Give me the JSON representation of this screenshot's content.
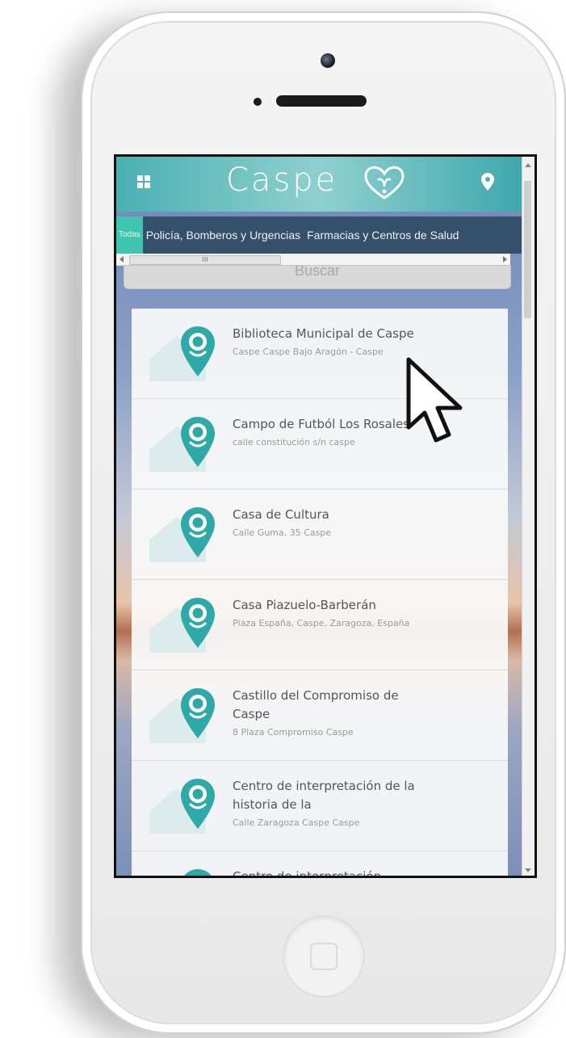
{
  "header": {
    "title": "Caspe",
    "menu_icon": "grid-icon",
    "logo_icon": "heart-hands-icon",
    "location_icon": "map-pin-icon"
  },
  "tabs": [
    {
      "label": "Todas",
      "active": true
    },
    {
      "label": "Policía, Bomberos y Urgencias",
      "active": false
    },
    {
      "label": "Farmacias y Centros de Salud",
      "active": false
    }
  ],
  "search": {
    "label": "Buscar"
  },
  "scroll": {
    "thumb_glyph": "III"
  },
  "places": [
    {
      "name": "Biblioteca Municipal de Caspe",
      "address": "Caspe Caspe Bajo Aragón - Caspe"
    },
    {
      "name": "Campo de Futból Los Rosales",
      "address": "calle constitución s/n caspe"
    },
    {
      "name": "Casa de Cultura",
      "address": "Calle Guma, 35 Caspe"
    },
    {
      "name": "Casa Piazuelo-Barberán",
      "address": "Plaza España, Caspe, Zaragoza, España"
    },
    {
      "name": "Castillo del Compromiso de Caspe",
      "address": "8 Plaza Compromiso Caspe"
    },
    {
      "name": "Centro de interpretación de la historia de la",
      "address": "Calle Zaragoza Caspe Caspe"
    },
    {
      "name": "Centro de interpretación",
      "address": ""
    }
  ],
  "colors": {
    "accent": "#2fa9a8",
    "tab_bar": "#34506a",
    "tab_active": "#3fc6b0"
  }
}
